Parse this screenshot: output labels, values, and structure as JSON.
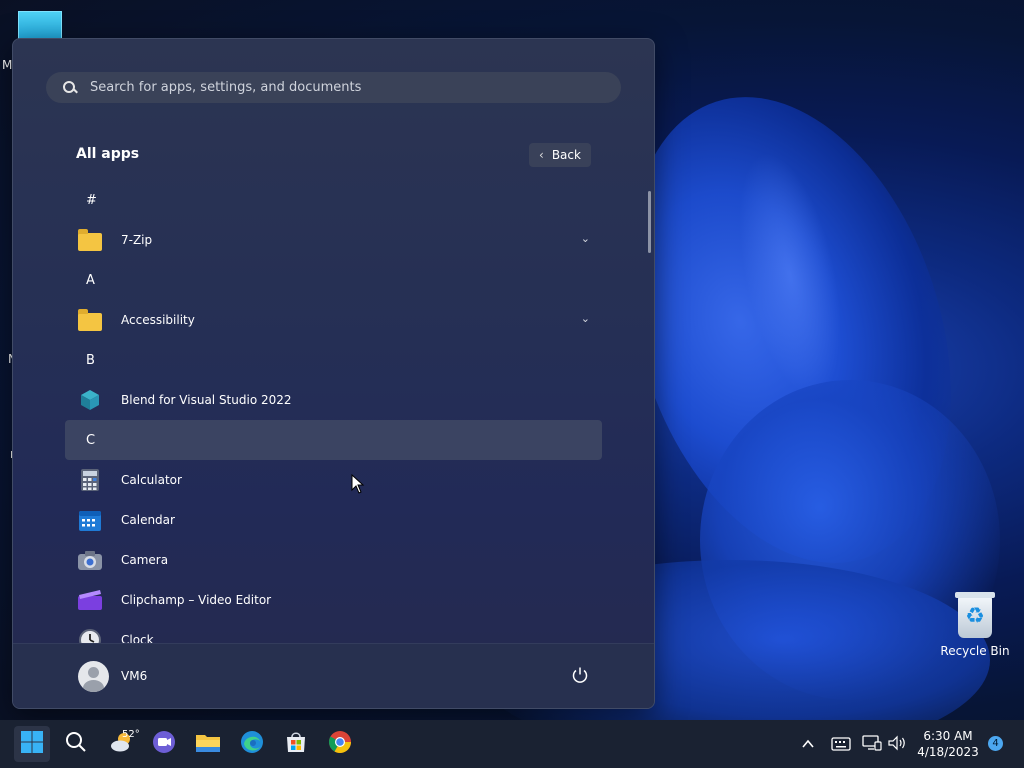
{
  "desktop": {
    "edge_letters": [
      "M",
      "N",
      "I"
    ],
    "recycle_bin_label": "Recycle Bin"
  },
  "start_menu": {
    "search_placeholder": "Search for apps, settings, and documents",
    "section_title": "All apps",
    "back_label": "Back",
    "items": [
      {
        "type": "letter",
        "text": "#"
      },
      {
        "type": "app",
        "label": "7-Zip",
        "icon": "folder-icon",
        "expandable": true
      },
      {
        "type": "letter",
        "text": "A"
      },
      {
        "type": "app",
        "label": "Accessibility",
        "icon": "folder-icon",
        "expandable": true
      },
      {
        "type": "letter",
        "text": "B"
      },
      {
        "type": "app",
        "label": "Blend for Visual Studio 2022",
        "icon": "blend-icon"
      },
      {
        "type": "letter",
        "text": "C",
        "hovered": true
      },
      {
        "type": "app",
        "label": "Calculator",
        "icon": "calculator-icon"
      },
      {
        "type": "app",
        "label": "Calendar",
        "icon": "calendar-icon"
      },
      {
        "type": "app",
        "label": "Camera",
        "icon": "camera-icon"
      },
      {
        "type": "app",
        "label": "Clipchamp – Video Editor",
        "icon": "clipchamp-icon"
      },
      {
        "type": "app",
        "label": "Clock",
        "icon": "clock-icon"
      }
    ],
    "user_name": "VM6",
    "power_icon": "power-icon"
  },
  "taskbar": {
    "weather_temp": "52°",
    "apps": [
      "start-icon",
      "search-icon",
      "weather-icon",
      "teams-meet-icon",
      "file-explorer-icon",
      "edge-icon",
      "store-icon",
      "chrome-icon"
    ],
    "time": "6:30 AM",
    "date": "4/18/2023",
    "notification_count": "4"
  },
  "colors": {
    "accent": "#4ca7f0",
    "start_bg": "#252f55",
    "taskbar_bg": "#1a2232"
  }
}
